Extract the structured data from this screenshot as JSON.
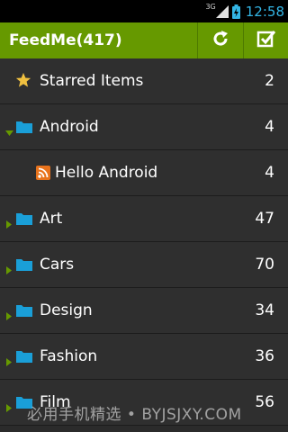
{
  "status_bar": {
    "network": "3G",
    "time": "12:58"
  },
  "action_bar": {
    "title": "FeedMe(417)",
    "buttons": [
      {
        "name": "refresh",
        "icon": "refresh-icon"
      },
      {
        "name": "mark-all-read",
        "icon": "checkbox-check-icon"
      }
    ]
  },
  "colors": {
    "action_bar": "#669900",
    "folder": "#1a9fd8",
    "rss": "#e8731c",
    "star": "#f0c040",
    "expander": "#669900",
    "clock": "#33b5e5"
  },
  "list": [
    {
      "label": "Starred Items",
      "count": "2"
    },
    {
      "label": "Android",
      "count": "4"
    },
    {
      "label": "Hello Android",
      "count": "4"
    },
    {
      "label": "Art",
      "count": "47"
    },
    {
      "label": "Cars",
      "count": "70"
    },
    {
      "label": "Design",
      "count": "34"
    },
    {
      "label": "Fashion",
      "count": "36"
    },
    {
      "label": "Film",
      "count": "56"
    }
  ],
  "watermark": "必用手机精选 • BYJSJXY.COM"
}
